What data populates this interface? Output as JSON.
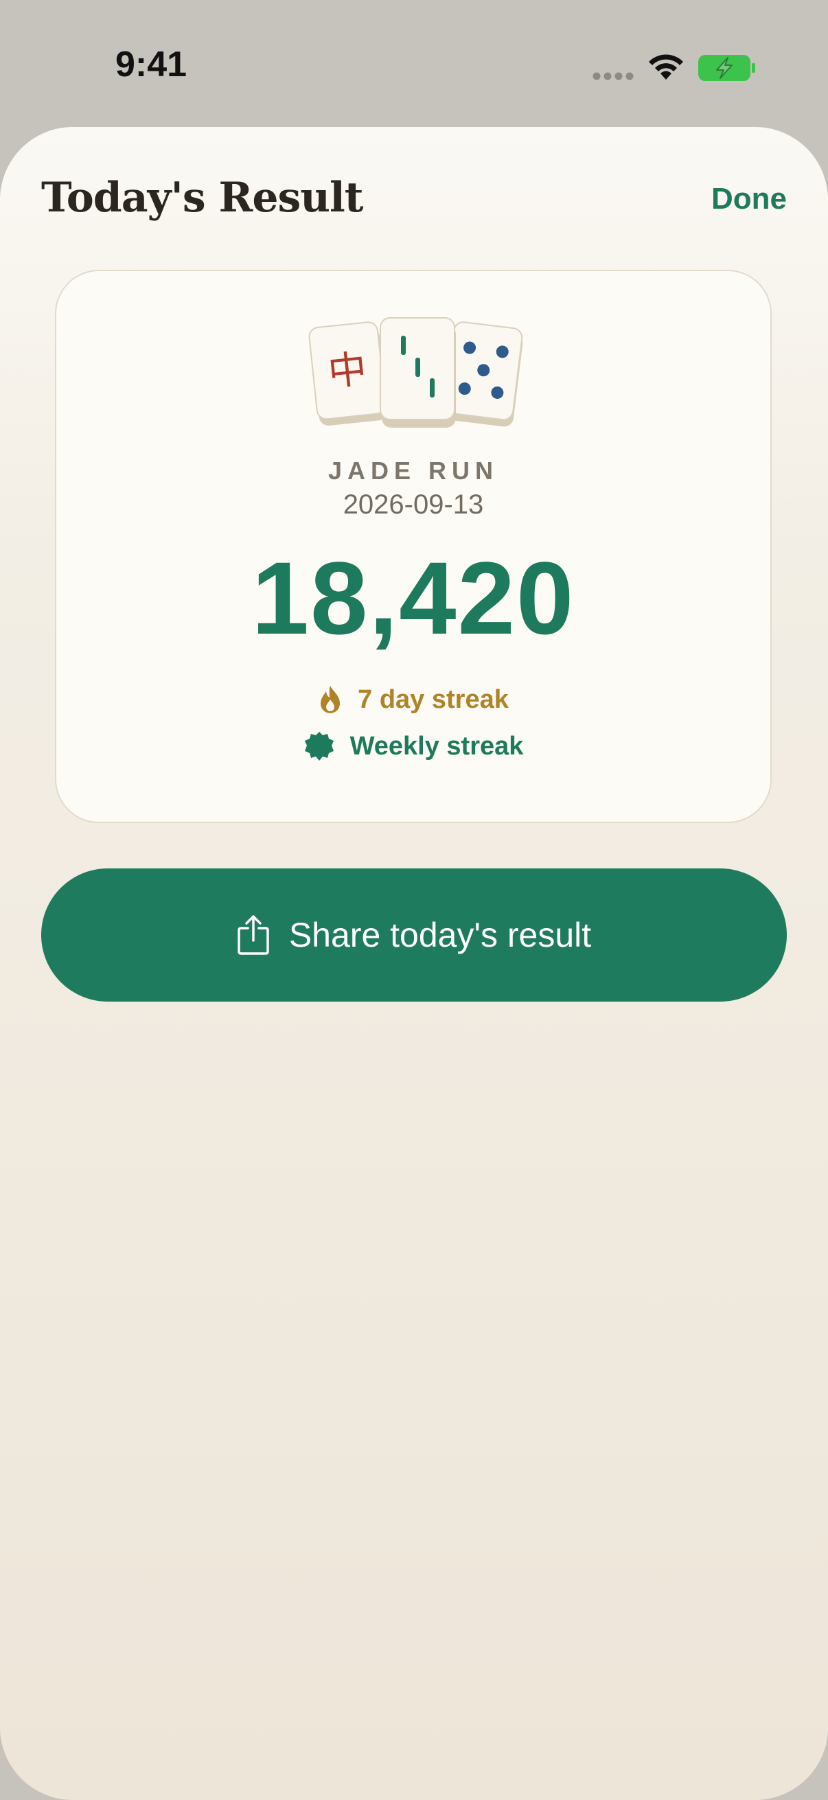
{
  "status_bar": {
    "time": "9:41",
    "icons": [
      "signal-dots-icon",
      "wifi-icon",
      "battery-charging-icon"
    ],
    "battery_color": "#3cc34b"
  },
  "sheet": {
    "title": "Today's Result",
    "done_label": "Done"
  },
  "result_card": {
    "tiles": [
      {
        "icon": "red-dragon-tile-icon",
        "glyph": "中",
        "color": "#b23a2c"
      },
      {
        "icon": "bamboo-three-tile-icon",
        "color": "#1d7a5c"
      },
      {
        "icon": "circles-five-tile-icon",
        "color": "#2c5b8c"
      }
    ],
    "game_name": "JADE RUN",
    "date": "2026-09-13",
    "score": "18,420",
    "streaks": [
      {
        "icon": "flame-icon",
        "label": "7 day streak",
        "color": "#b08326"
      },
      {
        "icon": "badge-seal-icon",
        "label": "Weekly streak",
        "color": "#1d7a5c"
      }
    ]
  },
  "share": {
    "icon": "share-icon",
    "label": "Share today's result"
  },
  "colors": {
    "accent": "#1d7a5c",
    "gold": "#b08326"
  }
}
